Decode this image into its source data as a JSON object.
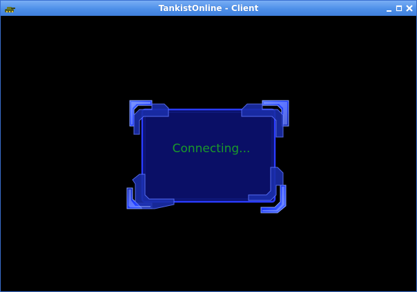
{
  "window": {
    "title": "TankistOnline - Client",
    "controls": [
      "minimize-icon",
      "maximize-icon",
      "close-icon"
    ]
  },
  "loader": {
    "status_text": "Connecting..."
  },
  "colors": {
    "titlebar": "#4d8fe8",
    "background": "#000000",
    "panel_fill": "#0a0f66",
    "panel_border": "#2a3cff",
    "corner_blue": "#1e3cff",
    "status_text": "#1a9a2a"
  }
}
